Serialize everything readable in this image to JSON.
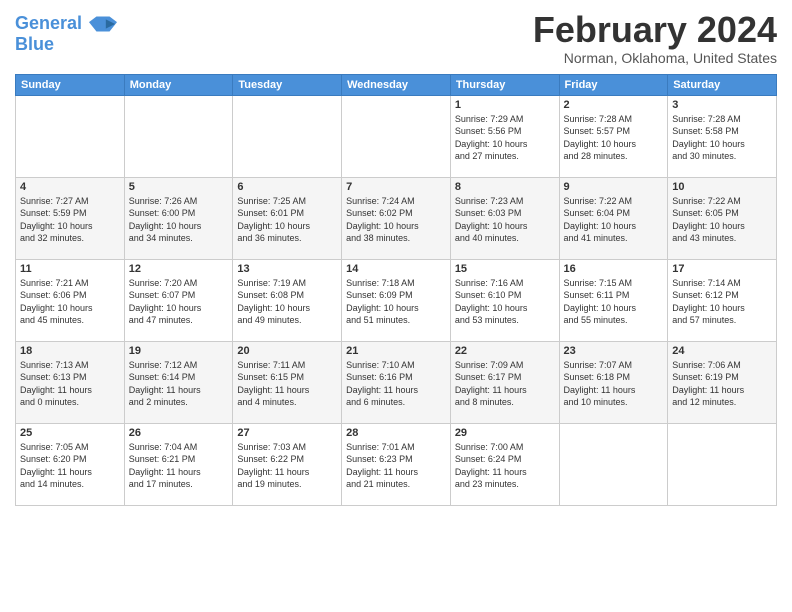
{
  "header": {
    "logo_line1": "General",
    "logo_line2": "Blue",
    "month_title": "February 2024",
    "location": "Norman, Oklahoma, United States"
  },
  "weekdays": [
    "Sunday",
    "Monday",
    "Tuesday",
    "Wednesday",
    "Thursday",
    "Friday",
    "Saturday"
  ],
  "weeks": [
    [
      {
        "day": "",
        "info": ""
      },
      {
        "day": "",
        "info": ""
      },
      {
        "day": "",
        "info": ""
      },
      {
        "day": "",
        "info": ""
      },
      {
        "day": "1",
        "info": "Sunrise: 7:29 AM\nSunset: 5:56 PM\nDaylight: 10 hours\nand 27 minutes."
      },
      {
        "day": "2",
        "info": "Sunrise: 7:28 AM\nSunset: 5:57 PM\nDaylight: 10 hours\nand 28 minutes."
      },
      {
        "day": "3",
        "info": "Sunrise: 7:28 AM\nSunset: 5:58 PM\nDaylight: 10 hours\nand 30 minutes."
      }
    ],
    [
      {
        "day": "4",
        "info": "Sunrise: 7:27 AM\nSunset: 5:59 PM\nDaylight: 10 hours\nand 32 minutes."
      },
      {
        "day": "5",
        "info": "Sunrise: 7:26 AM\nSunset: 6:00 PM\nDaylight: 10 hours\nand 34 minutes."
      },
      {
        "day": "6",
        "info": "Sunrise: 7:25 AM\nSunset: 6:01 PM\nDaylight: 10 hours\nand 36 minutes."
      },
      {
        "day": "7",
        "info": "Sunrise: 7:24 AM\nSunset: 6:02 PM\nDaylight: 10 hours\nand 38 minutes."
      },
      {
        "day": "8",
        "info": "Sunrise: 7:23 AM\nSunset: 6:03 PM\nDaylight: 10 hours\nand 40 minutes."
      },
      {
        "day": "9",
        "info": "Sunrise: 7:22 AM\nSunset: 6:04 PM\nDaylight: 10 hours\nand 41 minutes."
      },
      {
        "day": "10",
        "info": "Sunrise: 7:22 AM\nSunset: 6:05 PM\nDaylight: 10 hours\nand 43 minutes."
      }
    ],
    [
      {
        "day": "11",
        "info": "Sunrise: 7:21 AM\nSunset: 6:06 PM\nDaylight: 10 hours\nand 45 minutes."
      },
      {
        "day": "12",
        "info": "Sunrise: 7:20 AM\nSunset: 6:07 PM\nDaylight: 10 hours\nand 47 minutes."
      },
      {
        "day": "13",
        "info": "Sunrise: 7:19 AM\nSunset: 6:08 PM\nDaylight: 10 hours\nand 49 minutes."
      },
      {
        "day": "14",
        "info": "Sunrise: 7:18 AM\nSunset: 6:09 PM\nDaylight: 10 hours\nand 51 minutes."
      },
      {
        "day": "15",
        "info": "Sunrise: 7:16 AM\nSunset: 6:10 PM\nDaylight: 10 hours\nand 53 minutes."
      },
      {
        "day": "16",
        "info": "Sunrise: 7:15 AM\nSunset: 6:11 PM\nDaylight: 10 hours\nand 55 minutes."
      },
      {
        "day": "17",
        "info": "Sunrise: 7:14 AM\nSunset: 6:12 PM\nDaylight: 10 hours\nand 57 minutes."
      }
    ],
    [
      {
        "day": "18",
        "info": "Sunrise: 7:13 AM\nSunset: 6:13 PM\nDaylight: 11 hours\nand 0 minutes."
      },
      {
        "day": "19",
        "info": "Sunrise: 7:12 AM\nSunset: 6:14 PM\nDaylight: 11 hours\nand 2 minutes."
      },
      {
        "day": "20",
        "info": "Sunrise: 7:11 AM\nSunset: 6:15 PM\nDaylight: 11 hours\nand 4 minutes."
      },
      {
        "day": "21",
        "info": "Sunrise: 7:10 AM\nSunset: 6:16 PM\nDaylight: 11 hours\nand 6 minutes."
      },
      {
        "day": "22",
        "info": "Sunrise: 7:09 AM\nSunset: 6:17 PM\nDaylight: 11 hours\nand 8 minutes."
      },
      {
        "day": "23",
        "info": "Sunrise: 7:07 AM\nSunset: 6:18 PM\nDaylight: 11 hours\nand 10 minutes."
      },
      {
        "day": "24",
        "info": "Sunrise: 7:06 AM\nSunset: 6:19 PM\nDaylight: 11 hours\nand 12 minutes."
      }
    ],
    [
      {
        "day": "25",
        "info": "Sunrise: 7:05 AM\nSunset: 6:20 PM\nDaylight: 11 hours\nand 14 minutes."
      },
      {
        "day": "26",
        "info": "Sunrise: 7:04 AM\nSunset: 6:21 PM\nDaylight: 11 hours\nand 17 minutes."
      },
      {
        "day": "27",
        "info": "Sunrise: 7:03 AM\nSunset: 6:22 PM\nDaylight: 11 hours\nand 19 minutes."
      },
      {
        "day": "28",
        "info": "Sunrise: 7:01 AM\nSunset: 6:23 PM\nDaylight: 11 hours\nand 21 minutes."
      },
      {
        "day": "29",
        "info": "Sunrise: 7:00 AM\nSunset: 6:24 PM\nDaylight: 11 hours\nand 23 minutes."
      },
      {
        "day": "",
        "info": ""
      },
      {
        "day": "",
        "info": ""
      }
    ]
  ]
}
